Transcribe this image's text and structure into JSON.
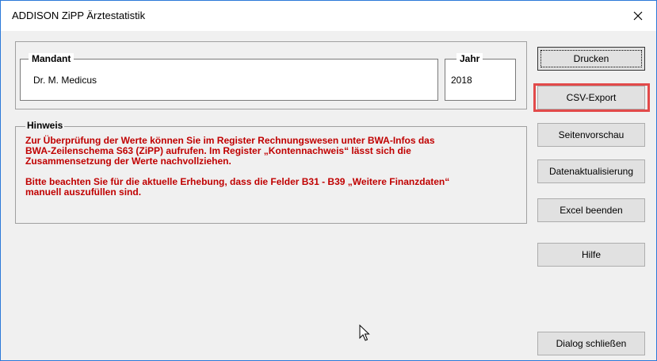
{
  "window": {
    "title": "ADDISON ZiPP Ärztestatistik"
  },
  "mandant": {
    "label": "Mandant",
    "value": "Dr. M. Medicus"
  },
  "jahr": {
    "label": "Jahr",
    "value": "2018"
  },
  "hinweis": {
    "label": "Hinweis",
    "line1": "Zur Überprüfung der Werte können Sie im Register Rechnungswesen unter BWA-Infos das",
    "line2": "BWA-Zeilenschema S63 (ZiPP) aufrufen. Im Register „Kontennachweis“ lässt sich die",
    "line3": "Zusammensetzung der Werte nachvollziehen.",
    "line4": "Bitte beachten Sie für die aktuelle Erhebung, dass die Felder B31 - B39 „Weitere Finanzdaten“",
    "line5": "manuell auszufüllen sind."
  },
  "buttons": {
    "drucken": "Drucken",
    "csv_export": "CSV-Export",
    "seitenvorschau": "Seitenvorschau",
    "datenaktualisierung": "Datenaktualisierung",
    "excel_beenden": "Excel beenden",
    "hilfe": "Hilfe",
    "dialog_schliessen": "Dialog schließen"
  },
  "colors": {
    "hint_text": "#c00000",
    "highlight_border": "#e24a4a",
    "window_border": "#2b79d8"
  },
  "icons": {
    "close": "close-icon",
    "cursor": "mouse-pointer-icon"
  }
}
